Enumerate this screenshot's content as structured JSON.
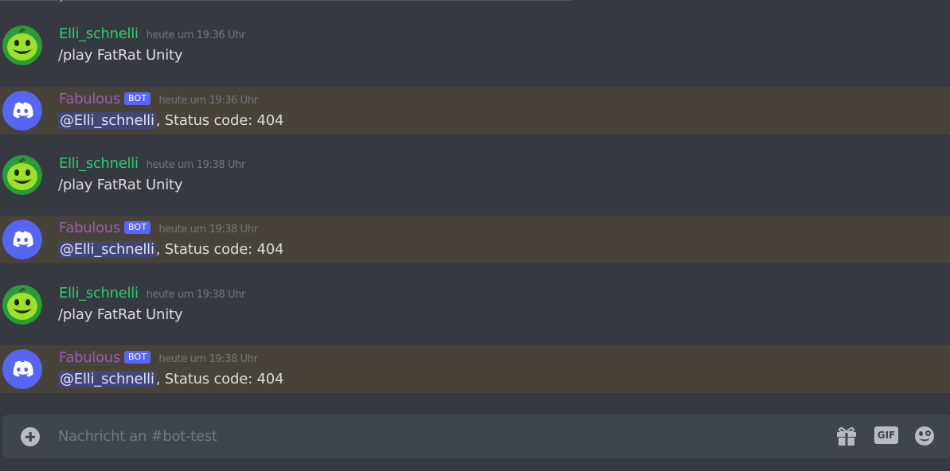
{
  "colors": {
    "background": "#36393f",
    "mention_row": "#48433a",
    "user_name": "#2ecc71",
    "bot_name": "#9b59b6",
    "bot_tag": "#5865f2",
    "mention_pill": "#414675",
    "composer": "#40444b"
  },
  "messages": [
    {
      "author": "Elli_schnelli",
      "timestamp": "heute um 19:36 Uhr",
      "text": "/play FatRat Unity",
      "avatar_icon": "green-apple-face-icon"
    },
    {
      "author": "Fabulous",
      "bot_tag": "BOT",
      "timestamp": "heute um 19:36 Uhr",
      "mention": "@Elli_schnelli",
      "text": ", Status code: 404",
      "avatar_icon": "discord-logo-icon"
    },
    {
      "author": "Elli_schnelli",
      "timestamp": "heute um 19:38 Uhr",
      "text": "/play FatRat Unity",
      "avatar_icon": "green-apple-face-icon"
    },
    {
      "author": "Fabulous",
      "bot_tag": "BOT",
      "timestamp": "heute um 19:38 Uhr",
      "mention": "@Elli_schnelli",
      "text": ", Status code: 404",
      "avatar_icon": "discord-logo-icon"
    },
    {
      "author": "Elli_schnelli",
      "timestamp": "heute um 19:38 Uhr",
      "text": "/play FatRat Unity",
      "avatar_icon": "green-apple-face-icon"
    },
    {
      "author": "Fabulous",
      "bot_tag": "BOT",
      "timestamp": "heute um 19:38 Uhr",
      "mention": "@Elli_schnelli",
      "text": ", Status code: 404",
      "avatar_icon": "discord-logo-icon"
    }
  ],
  "composer": {
    "placeholder": "Nachricht an #bot-test",
    "gif_label": "GIF",
    "icons": [
      "plus-circle-icon",
      "gift-icon",
      "gif-icon",
      "emoji-icon"
    ]
  }
}
